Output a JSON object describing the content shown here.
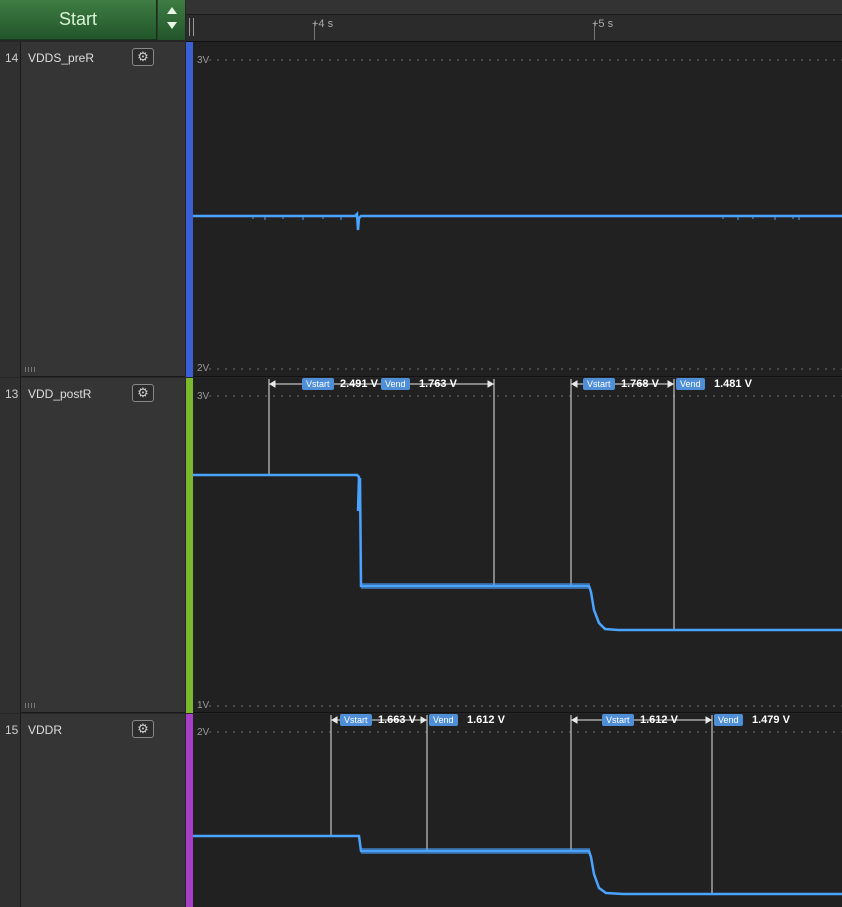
{
  "header": {
    "start_label": "Start",
    "ruler_ticks": [
      "+4 s",
      "+5 s"
    ]
  },
  "colors": {
    "waveform": "#4aa3ff",
    "marker": "#4f8fd8"
  },
  "channels": [
    {
      "number": "14",
      "name": "VDDS_preR",
      "color": "#3c5fd6",
      "axis_top": "3V",
      "axis_bottom": "2V",
      "measurements": []
    },
    {
      "number": "13",
      "name": "VDD_postR",
      "color": "#7cb82e",
      "axis_top": "3V",
      "axis_bottom": "1V",
      "measurements": [
        {
          "vstart_label": "Vstart",
          "vstart_value": "2.491 V",
          "vend_label": "Vend",
          "vend_value": "1.763 V"
        },
        {
          "vstart_label": "Vstart",
          "vstart_value": "1.768 V",
          "vend_label": "Vend",
          "vend_value": "1.481 V"
        }
      ]
    },
    {
      "number": "15",
      "name": "VDDR",
      "color": "#a83fc8",
      "axis_top": "2V",
      "axis_bottom": "",
      "measurements": [
        {
          "vstart_label": "Vstart",
          "vstart_value": "1.663 V",
          "vend_label": "Vend",
          "vend_value": "1.612 V"
        },
        {
          "vstart_label": "Vstart",
          "vstart_value": "1.612 V",
          "vend_label": "Vend",
          "vend_value": "1.479 V"
        }
      ]
    }
  ]
}
